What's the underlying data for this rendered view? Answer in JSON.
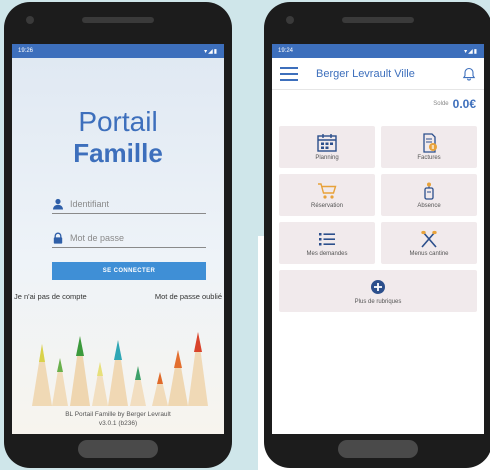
{
  "left_phone": {
    "status_time": "19:26",
    "brand_line1": "Portail",
    "brand_line2": "Famille",
    "username_placeholder": "Identifiant",
    "password_placeholder": "Mot de passe",
    "connect_button": "SE CONNECTER",
    "no_account_link": "Je n'ai pas de compte",
    "forgot_password_link": "Mot de passe oublié",
    "footer_line1": "BL Portail Famille by Berger Levrault",
    "footer_line2": "v3.0.1 (b236)"
  },
  "right_phone": {
    "status_time": "19:24",
    "app_title": "Berger Levrault Ville",
    "balance_label": "Solde",
    "balance_value": "0.0€",
    "tiles": [
      {
        "label": "Planning",
        "icon": "calendar-icon"
      },
      {
        "label": "Factures",
        "icon": "invoice-icon"
      },
      {
        "label": "Réservation",
        "icon": "cart-icon"
      },
      {
        "label": "Absence",
        "icon": "absence-icon"
      },
      {
        "label": "Mes demandes",
        "icon": "list-icon"
      },
      {
        "label": "Menus cantine",
        "icon": "cutlery-icon"
      }
    ],
    "more_label": "Plus de rubriques"
  },
  "colors": {
    "brand_blue": "#3d6fbc",
    "button_blue": "#3f8fd6",
    "tile_bg": "#f1eaec",
    "icon_orange": "#e8a23a",
    "background_teal": "#cfe6ea"
  }
}
